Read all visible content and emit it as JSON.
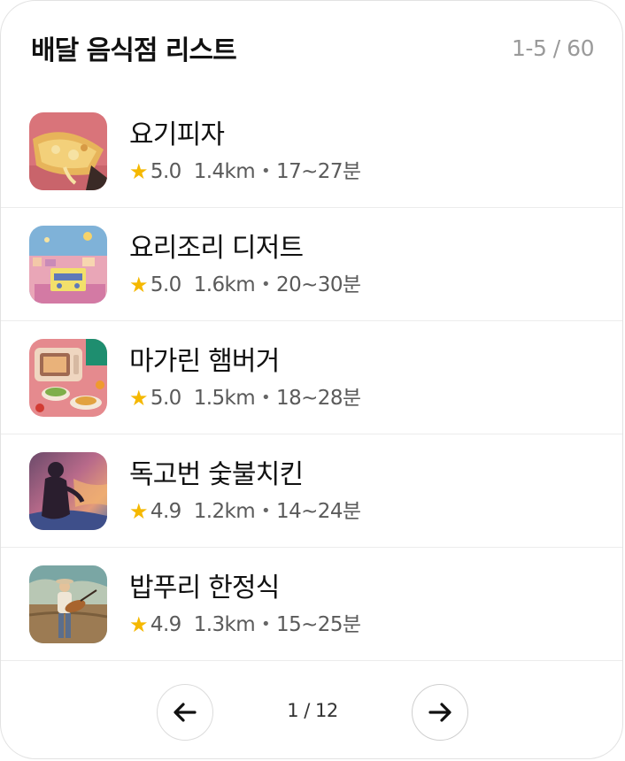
{
  "header": {
    "title": "배달 음식점 리스트",
    "range": "1-5 / 60"
  },
  "restaurants": [
    {
      "name": "요기피자",
      "rating": "5.0",
      "distance": "1.4km",
      "time": "17~27분",
      "thumb_icon": "pizza-photo"
    },
    {
      "name": "요리조리 디저트",
      "rating": "5.0",
      "distance": "1.6km",
      "time": "20~30분",
      "thumb_icon": "city-radio-illustration"
    },
    {
      "name": "마가린 햄버거",
      "rating": "5.0",
      "distance": "1.5km",
      "time": "18~28분",
      "thumb_icon": "oven-food-illustration"
    },
    {
      "name": "독고번 숯불치킨",
      "rating": "4.9",
      "distance": "1.2km",
      "time": "14~24분",
      "thumb_icon": "silhouette-sky-illustration"
    },
    {
      "name": "밥푸리 한정식",
      "rating": "4.9",
      "distance": "1.3km",
      "time": "15~25분",
      "thumb_icon": "guitarist-field-illustration"
    }
  ],
  "pagination": {
    "page": "1 / 12",
    "prev_icon": "arrow-left-icon",
    "next_icon": "arrow-right-icon"
  },
  "colors": {
    "star": "#f5b800",
    "muted": "#9a9a9a",
    "divider": "#ececec"
  }
}
